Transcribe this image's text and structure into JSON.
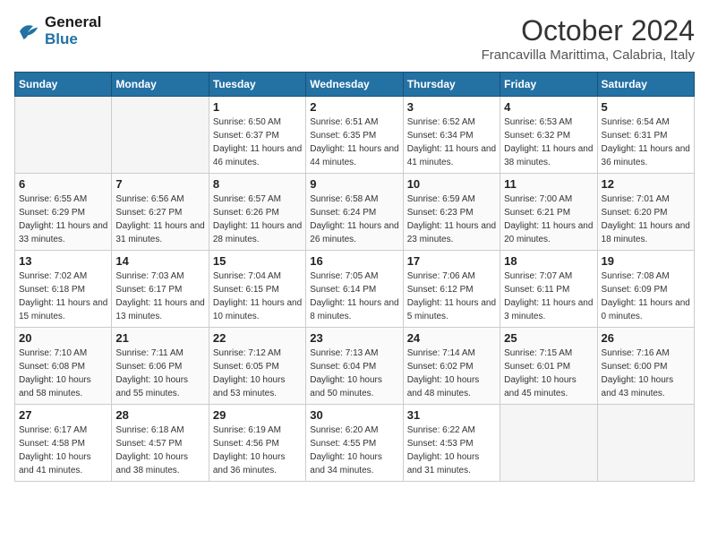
{
  "header": {
    "logo_line1": "General",
    "logo_line2": "Blue",
    "month_title": "October 2024",
    "location": "Francavilla Marittima, Calabria, Italy"
  },
  "weekdays": [
    "Sunday",
    "Monday",
    "Tuesday",
    "Wednesday",
    "Thursday",
    "Friday",
    "Saturday"
  ],
  "weeks": [
    [
      {
        "day": "",
        "sunrise": "",
        "sunset": "",
        "daylight": ""
      },
      {
        "day": "",
        "sunrise": "",
        "sunset": "",
        "daylight": ""
      },
      {
        "day": "1",
        "sunrise": "Sunrise: 6:50 AM",
        "sunset": "Sunset: 6:37 PM",
        "daylight": "Daylight: 11 hours and 46 minutes."
      },
      {
        "day": "2",
        "sunrise": "Sunrise: 6:51 AM",
        "sunset": "Sunset: 6:35 PM",
        "daylight": "Daylight: 11 hours and 44 minutes."
      },
      {
        "day": "3",
        "sunrise": "Sunrise: 6:52 AM",
        "sunset": "Sunset: 6:34 PM",
        "daylight": "Daylight: 11 hours and 41 minutes."
      },
      {
        "day": "4",
        "sunrise": "Sunrise: 6:53 AM",
        "sunset": "Sunset: 6:32 PM",
        "daylight": "Daylight: 11 hours and 38 minutes."
      },
      {
        "day": "5",
        "sunrise": "Sunrise: 6:54 AM",
        "sunset": "Sunset: 6:31 PM",
        "daylight": "Daylight: 11 hours and 36 minutes."
      }
    ],
    [
      {
        "day": "6",
        "sunrise": "Sunrise: 6:55 AM",
        "sunset": "Sunset: 6:29 PM",
        "daylight": "Daylight: 11 hours and 33 minutes."
      },
      {
        "day": "7",
        "sunrise": "Sunrise: 6:56 AM",
        "sunset": "Sunset: 6:27 PM",
        "daylight": "Daylight: 11 hours and 31 minutes."
      },
      {
        "day": "8",
        "sunrise": "Sunrise: 6:57 AM",
        "sunset": "Sunset: 6:26 PM",
        "daylight": "Daylight: 11 hours and 28 minutes."
      },
      {
        "day": "9",
        "sunrise": "Sunrise: 6:58 AM",
        "sunset": "Sunset: 6:24 PM",
        "daylight": "Daylight: 11 hours and 26 minutes."
      },
      {
        "day": "10",
        "sunrise": "Sunrise: 6:59 AM",
        "sunset": "Sunset: 6:23 PM",
        "daylight": "Daylight: 11 hours and 23 minutes."
      },
      {
        "day": "11",
        "sunrise": "Sunrise: 7:00 AM",
        "sunset": "Sunset: 6:21 PM",
        "daylight": "Daylight: 11 hours and 20 minutes."
      },
      {
        "day": "12",
        "sunrise": "Sunrise: 7:01 AM",
        "sunset": "Sunset: 6:20 PM",
        "daylight": "Daylight: 11 hours and 18 minutes."
      }
    ],
    [
      {
        "day": "13",
        "sunrise": "Sunrise: 7:02 AM",
        "sunset": "Sunset: 6:18 PM",
        "daylight": "Daylight: 11 hours and 15 minutes."
      },
      {
        "day": "14",
        "sunrise": "Sunrise: 7:03 AM",
        "sunset": "Sunset: 6:17 PM",
        "daylight": "Daylight: 11 hours and 13 minutes."
      },
      {
        "day": "15",
        "sunrise": "Sunrise: 7:04 AM",
        "sunset": "Sunset: 6:15 PM",
        "daylight": "Daylight: 11 hours and 10 minutes."
      },
      {
        "day": "16",
        "sunrise": "Sunrise: 7:05 AM",
        "sunset": "Sunset: 6:14 PM",
        "daylight": "Daylight: 11 hours and 8 minutes."
      },
      {
        "day": "17",
        "sunrise": "Sunrise: 7:06 AM",
        "sunset": "Sunset: 6:12 PM",
        "daylight": "Daylight: 11 hours and 5 minutes."
      },
      {
        "day": "18",
        "sunrise": "Sunrise: 7:07 AM",
        "sunset": "Sunset: 6:11 PM",
        "daylight": "Daylight: 11 hours and 3 minutes."
      },
      {
        "day": "19",
        "sunrise": "Sunrise: 7:08 AM",
        "sunset": "Sunset: 6:09 PM",
        "daylight": "Daylight: 11 hours and 0 minutes."
      }
    ],
    [
      {
        "day": "20",
        "sunrise": "Sunrise: 7:10 AM",
        "sunset": "Sunset: 6:08 PM",
        "daylight": "Daylight: 10 hours and 58 minutes."
      },
      {
        "day": "21",
        "sunrise": "Sunrise: 7:11 AM",
        "sunset": "Sunset: 6:06 PM",
        "daylight": "Daylight: 10 hours and 55 minutes."
      },
      {
        "day": "22",
        "sunrise": "Sunrise: 7:12 AM",
        "sunset": "Sunset: 6:05 PM",
        "daylight": "Daylight: 10 hours and 53 minutes."
      },
      {
        "day": "23",
        "sunrise": "Sunrise: 7:13 AM",
        "sunset": "Sunset: 6:04 PM",
        "daylight": "Daylight: 10 hours and 50 minutes."
      },
      {
        "day": "24",
        "sunrise": "Sunrise: 7:14 AM",
        "sunset": "Sunset: 6:02 PM",
        "daylight": "Daylight: 10 hours and 48 minutes."
      },
      {
        "day": "25",
        "sunrise": "Sunrise: 7:15 AM",
        "sunset": "Sunset: 6:01 PM",
        "daylight": "Daylight: 10 hours and 45 minutes."
      },
      {
        "day": "26",
        "sunrise": "Sunrise: 7:16 AM",
        "sunset": "Sunset: 6:00 PM",
        "daylight": "Daylight: 10 hours and 43 minutes."
      }
    ],
    [
      {
        "day": "27",
        "sunrise": "Sunrise: 6:17 AM",
        "sunset": "Sunset: 4:58 PM",
        "daylight": "Daylight: 10 hours and 41 minutes."
      },
      {
        "day": "28",
        "sunrise": "Sunrise: 6:18 AM",
        "sunset": "Sunset: 4:57 PM",
        "daylight": "Daylight: 10 hours and 38 minutes."
      },
      {
        "day": "29",
        "sunrise": "Sunrise: 6:19 AM",
        "sunset": "Sunset: 4:56 PM",
        "daylight": "Daylight: 10 hours and 36 minutes."
      },
      {
        "day": "30",
        "sunrise": "Sunrise: 6:20 AM",
        "sunset": "Sunset: 4:55 PM",
        "daylight": "Daylight: 10 hours and 34 minutes."
      },
      {
        "day": "31",
        "sunrise": "Sunrise: 6:22 AM",
        "sunset": "Sunset: 4:53 PM",
        "daylight": "Daylight: 10 hours and 31 minutes."
      },
      {
        "day": "",
        "sunrise": "",
        "sunset": "",
        "daylight": ""
      },
      {
        "day": "",
        "sunrise": "",
        "sunset": "",
        "daylight": ""
      }
    ]
  ]
}
